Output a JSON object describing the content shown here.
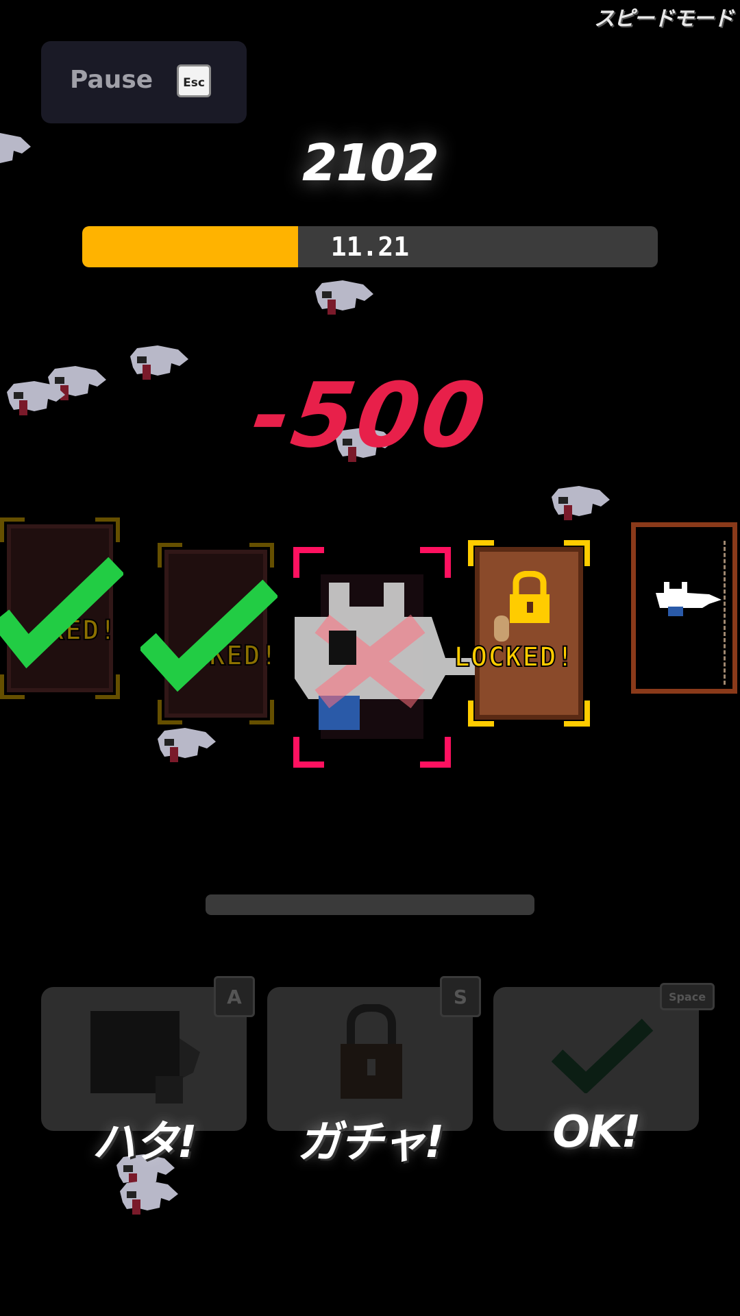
{
  "mode_label": "スピードモード",
  "pause": {
    "label": "Pause",
    "key": "Esc"
  },
  "score": "2102",
  "timer": {
    "value": "11.21",
    "fill_fraction": 0.375,
    "fill_color": "#ffb300"
  },
  "penalty": "-500",
  "doors": {
    "locked_label": "LOCKED!",
    "partial_label_1": "KED!",
    "partial_label_2": "CKED!",
    "check_color": "#22cc44",
    "target_color": "#ff1160"
  },
  "progress": {
    "fill_fraction": 0.0
  },
  "actions": [
    {
      "label": "ハタ!",
      "key": "A"
    },
    {
      "label": "ガチャ!",
      "key": "S"
    },
    {
      "label": "OK!",
      "key": "Space"
    }
  ],
  "colors": {
    "accent_yellow": "#ffb300",
    "penalty_red": "#e8204a",
    "background": "#000000"
  }
}
